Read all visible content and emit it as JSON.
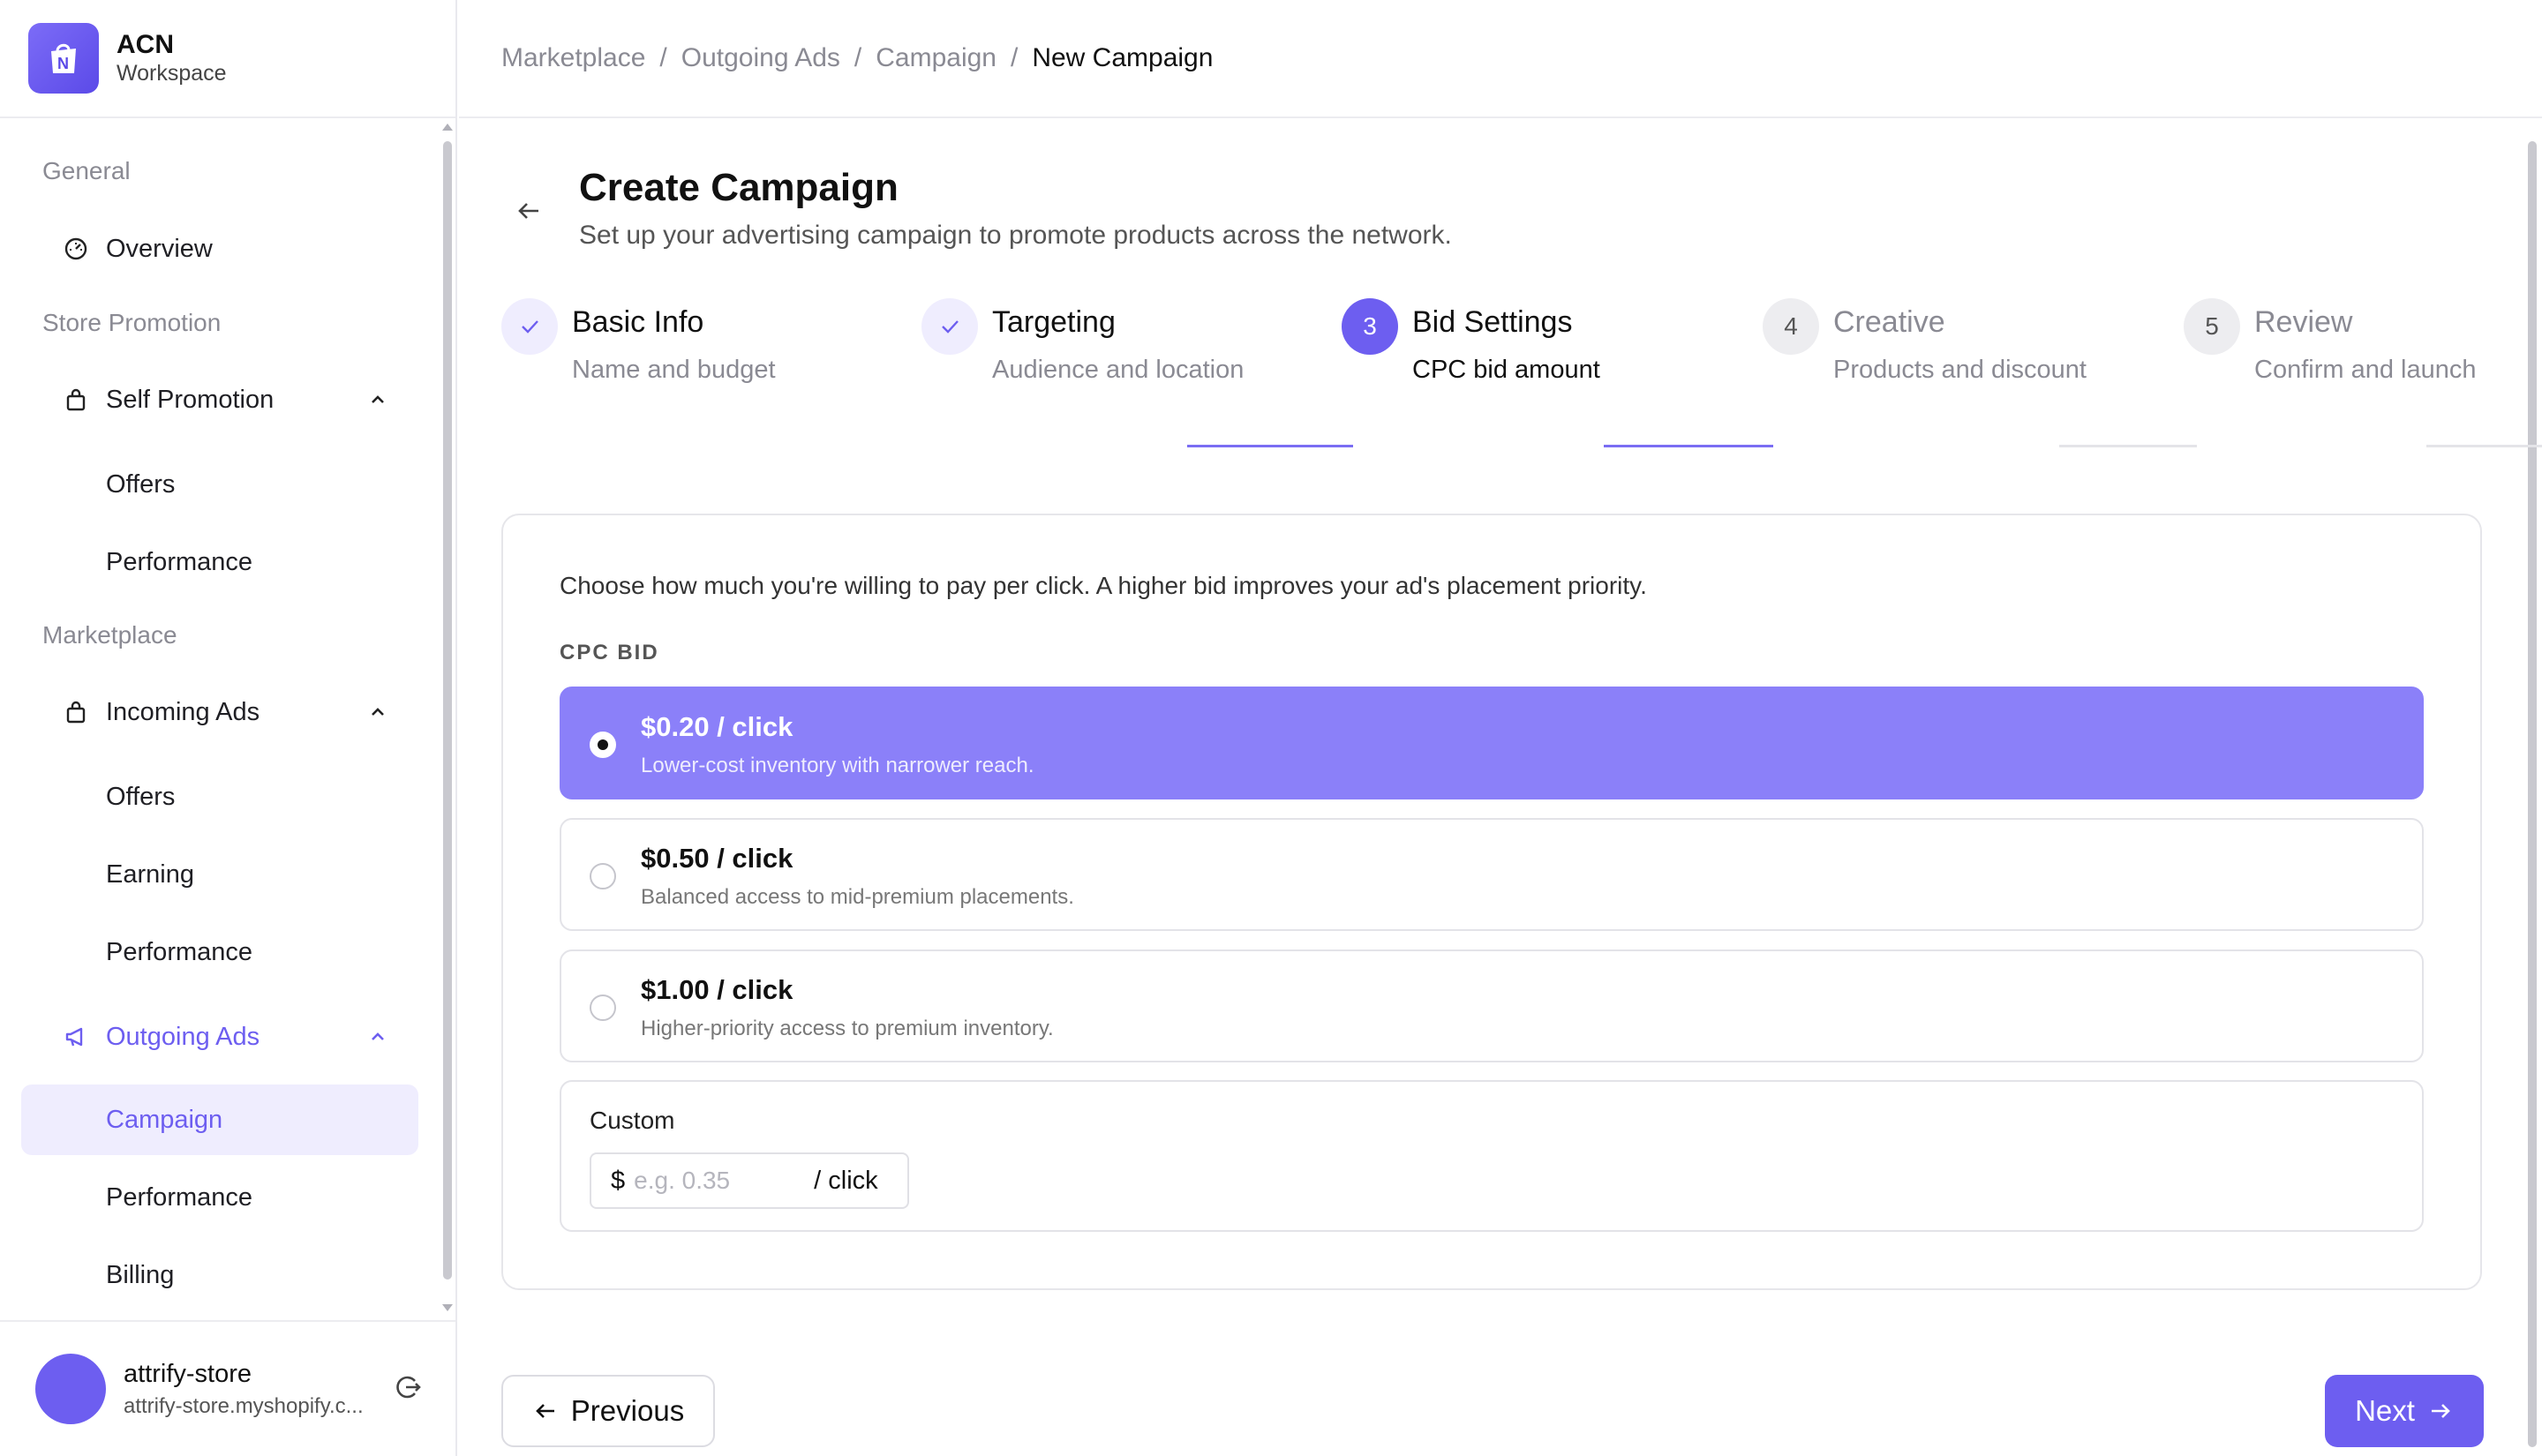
{
  "brand": {
    "name": "ACN",
    "subtitle": "Workspace"
  },
  "sidebar": {
    "sections": [
      {
        "label": "General"
      },
      {
        "label": "Store Promotion"
      },
      {
        "label": "Marketplace"
      }
    ],
    "overview": "Overview",
    "self_promotion": {
      "label": "Self Promotion",
      "children": [
        "Offers",
        "Performance"
      ]
    },
    "incoming_ads": {
      "label": "Incoming Ads",
      "children": [
        "Offers",
        "Earning",
        "Performance"
      ]
    },
    "outgoing_ads": {
      "label": "Outgoing Ads",
      "children": [
        "Campaign",
        "Performance",
        "Billing"
      ]
    }
  },
  "user": {
    "name": "attrify-store",
    "domain": "attrify-store.myshopify.c..."
  },
  "breadcrumb": [
    "Marketplace",
    "Outgoing Ads",
    "Campaign",
    "New Campaign"
  ],
  "page": {
    "title": "Create Campaign",
    "subtitle": "Set up your advertising campaign to promote products across the network."
  },
  "steps": [
    {
      "number": "1",
      "title": "Basic Info",
      "desc": "Name and budget",
      "state": "done"
    },
    {
      "number": "2",
      "title": "Targeting",
      "desc": "Audience and location",
      "state": "done"
    },
    {
      "number": "3",
      "title": "Bid Settings",
      "desc": "CPC bid amount",
      "state": "current"
    },
    {
      "number": "4",
      "title": "Creative",
      "desc": "Products and discount",
      "state": "todo"
    },
    {
      "number": "5",
      "title": "Review",
      "desc": "Confirm and launch",
      "state": "todo"
    }
  ],
  "bid": {
    "intro": "Choose how much you're willing to pay per click. A higher bid improves your ad's placement priority.",
    "label": "CPC BID",
    "options": [
      {
        "title": "$0.20 / click",
        "desc": "Lower-cost inventory with narrower reach.",
        "selected": true
      },
      {
        "title": "$0.50 / click",
        "desc": "Balanced access to mid-premium placements.",
        "selected": false
      },
      {
        "title": "$1.00 / click",
        "desc": "Higher-priority access to premium inventory.",
        "selected": false
      }
    ],
    "custom": {
      "label": "Custom",
      "currency": "$",
      "placeholder": "e.g. 0.35",
      "value": "",
      "unit": "/ click"
    }
  },
  "actions": {
    "previous": "Previous",
    "next": "Next"
  },
  "colors": {
    "accent": "#6d5ef0",
    "selected_option": "#8b80f9",
    "accent_light": "#efedfe"
  }
}
